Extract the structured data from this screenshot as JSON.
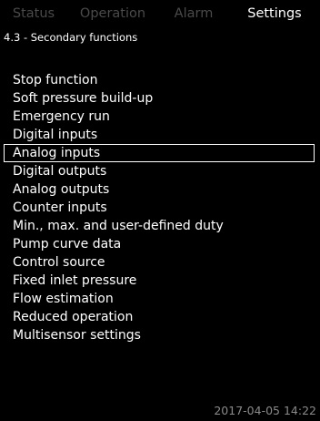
{
  "tabs": [
    {
      "label": "Status",
      "active": false
    },
    {
      "label": "Operation",
      "active": false
    },
    {
      "label": "Alarm",
      "active": false
    },
    {
      "label": "Settings",
      "active": true
    }
  ],
  "breadcrumb": "4.3 - Secondary functions",
  "menu": {
    "selected_index": 4,
    "items": [
      "Stop function",
      "Soft pressure build-up",
      "Emergency run",
      "Digital inputs",
      "Analog inputs",
      "Digital outputs",
      "Analog outputs",
      "Counter inputs",
      "Min., max. and user-defined duty",
      "Pump curve data",
      "Control source",
      "Fixed inlet pressure",
      "Flow estimation",
      "Reduced operation",
      "Multisensor settings"
    ]
  },
  "timestamp": "2017-04-05 14:22"
}
